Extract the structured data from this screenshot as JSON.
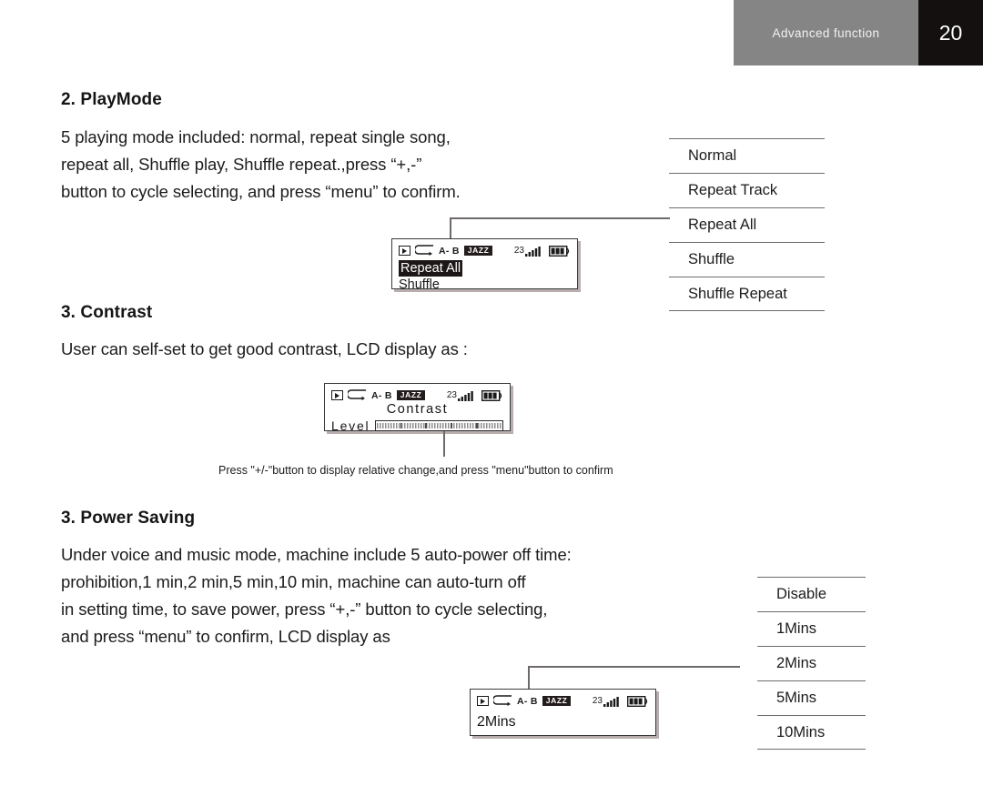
{
  "header": {
    "title": "Advanced function",
    "page_number": "20"
  },
  "sections": {
    "playmode": {
      "heading": "2. PlayMode",
      "body": "5 playing mode included: normal, repeat single song,\nrepeat all, Shuffle play, Shuffle repeat.,press  “+,-”\nbutton to cycle selecting, and press “menu” to confirm.",
      "options": [
        "Normal",
        "Repeat Track",
        "Repeat All",
        "Shuffle",
        "Shuffle Repeat"
      ],
      "lcd": {
        "status": {
          "play_icon": "play-icon",
          "repeat_icon": "repeat-icon",
          "ab_label": "A- B",
          "genre": "JAZZ",
          "volume": "23",
          "signal_icon": "signal-bars-icon",
          "battery_icon": "battery-icon"
        },
        "selected_item": "Repeat All",
        "next_item": "Shuffle"
      }
    },
    "contrast": {
      "heading": "3. Contrast",
      "body": "User can self-set to get good contrast, LCD display as :",
      "lcd": {
        "status": {
          "play_icon": "play-icon",
          "repeat_icon": "repeat-icon",
          "ab_label": "A- B",
          "genre": "JAZZ",
          "volume": "23",
          "signal_icon": "signal-bars-icon",
          "battery_icon": "battery-icon"
        },
        "title": "Contrast",
        "level_label": "Level",
        "level_percent": 100
      },
      "caption": "Press \"+/-\"button to display relative change,and press \"menu\"button to confirm"
    },
    "power_saving": {
      "heading": "3. Power Saving",
      "body": "Under voice and music mode, machine include 5 auto-power off time:\nprohibition,1 min,2 min,5 min,10 min, machine can auto-turn off\nin setting time, to save power, press  “+,-”  button to cycle selecting,\nand press “menu” to confirm, LCD display as",
      "options": [
        "Disable",
        "1Mins",
        "2Mins",
        "5Mins",
        "10Mins"
      ],
      "lcd": {
        "status": {
          "play_icon": "play-icon",
          "repeat_icon": "repeat-icon",
          "ab_label": "A- B",
          "genre": "JAZZ",
          "volume": "23",
          "signal_icon": "signal-bars-icon",
          "battery_icon": "battery-icon"
        },
        "selected_item": "2Mins"
      }
    }
  },
  "colors": {
    "header_bg": "#858585",
    "page_bg": "#141010",
    "rule": "#6f6a6a",
    "lcd_border": "#3a3a3a",
    "highlight": "#1d1717"
  }
}
